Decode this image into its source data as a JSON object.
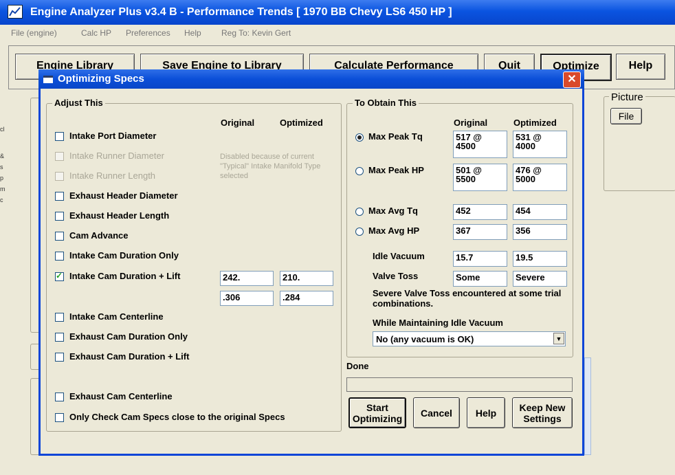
{
  "main_window": {
    "title": "Engine Analyzer Plus v3.4 B - Performance Trends   [ 1970 BB Chevy LS6 450 HP ]",
    "menu": [
      "File (engine)",
      "Calc HP",
      "Preferences",
      "Help",
      "Reg To: Kevin Gert"
    ],
    "toolbar": {
      "engine_library": "Engine Library",
      "save_engine": "Save Engine to Library",
      "calculate": "Calculate Performance",
      "quit": "Quit",
      "optimize": "Optimize",
      "help": "Help"
    },
    "picture_label": "Picture",
    "file_button": "File",
    "side_marks": [
      "cl",
      "&",
      "s",
      "p",
      "m",
      "c"
    ]
  },
  "dialog": {
    "title": "Optimizing Specs",
    "close_glyph": "✕",
    "adjust": {
      "label": "Adjust This",
      "col_original": "Original",
      "col_optimized": "Optimized",
      "items": [
        {
          "label": "Intake Port Diameter",
          "checked": false,
          "disabled": false
        },
        {
          "label": "Intake Runner Diameter",
          "checked": false,
          "disabled": true
        },
        {
          "label": "Intake Runner Length",
          "checked": false,
          "disabled": true
        },
        {
          "label": "Exhaust Header Diameter",
          "checked": false,
          "disabled": false
        },
        {
          "label": "Exhaust Header Length",
          "checked": false,
          "disabled": false
        },
        {
          "label": "Cam Advance",
          "checked": false,
          "disabled": false
        },
        {
          "label": "Intake Cam Duration Only",
          "checked": false,
          "disabled": false
        },
        {
          "label": "Intake Cam Duration + Lift",
          "checked": true,
          "disabled": false
        },
        {
          "label": "Intake Cam Centerline",
          "checked": false,
          "disabled": false
        },
        {
          "label": "Exhaust Cam Duration Only",
          "checked": false,
          "disabled": false
        },
        {
          "label": "Exhaust Cam Duration + Lift",
          "checked": false,
          "disabled": false
        },
        {
          "label": "Exhaust Cam Centerline",
          "checked": false,
          "disabled": false
        },
        {
          "label": "Only Check Cam Specs close to the original Specs",
          "checked": false,
          "disabled": false
        }
      ],
      "disabled_note": "Disabled because of current \"Typical\" Intake Manifold Type selected",
      "duration_original": "242.",
      "duration_optimized": "210.",
      "lift_original": ".306",
      "lift_optimized": ".284"
    },
    "obtain": {
      "label": "To Obtain This",
      "col_original": "Original",
      "col_optimized": "Optimized",
      "targets": [
        {
          "label": "Max Peak Tq",
          "selected": true,
          "original": "517 @\n4500",
          "optimized": "531 @\n4000"
        },
        {
          "label": "Max Peak HP",
          "selected": false,
          "original": "501 @\n5500",
          "optimized": "476 @\n5000"
        },
        {
          "label": "Max Avg Tq",
          "selected": false,
          "original": "452",
          "optimized": "454"
        },
        {
          "label": "Max Avg HP",
          "selected": false,
          "original": "367",
          "optimized": "356"
        }
      ],
      "idle_vacuum": {
        "label": "Idle Vacuum",
        "original": "15.7",
        "optimized": "19.5"
      },
      "valve_toss": {
        "label": "Valve Toss",
        "original": "Some",
        "optimized": "Severe"
      },
      "warning": "Severe Valve Toss encountered at some trial combinations.",
      "maintain_label": "While Maintaining Idle Vacuum",
      "maintain_value": "No (any vacuum is OK)"
    },
    "status": "Done",
    "buttons": {
      "start": "Start Optimizing",
      "cancel": "Cancel",
      "help": "Help",
      "keep": "Keep New Settings"
    }
  }
}
